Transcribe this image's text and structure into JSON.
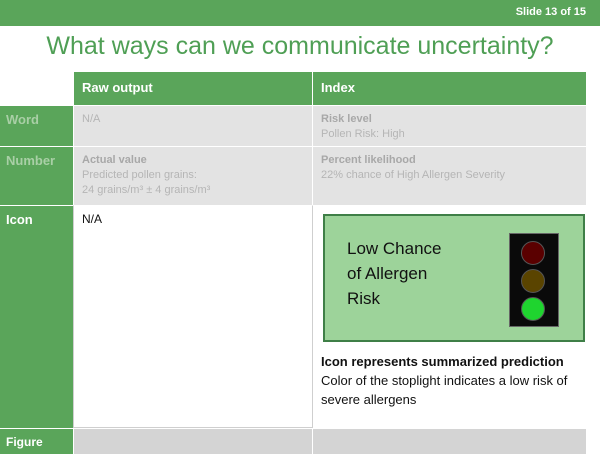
{
  "slide_number": "Slide 13 of 15",
  "title": "What ways can we communicate uncertainty?",
  "table": {
    "headers": [
      "",
      "Raw output",
      "Index"
    ],
    "word": {
      "label": "Word",
      "raw": "N/A",
      "index_title": "Risk level",
      "index_text": "Pollen Risk: High"
    },
    "number": {
      "label": "Number",
      "raw_title": "Actual value",
      "raw_line1": "Predicted pollen grains:",
      "raw_line2": "24 grains/m³ ± 4 grains/m³",
      "index_title": "Percent likelihood",
      "index_text": "22% chance of High Allergen Severity"
    },
    "icon": {
      "label": "Icon",
      "raw": "N/A",
      "icon_text_line1": "Low Chance",
      "icon_text_line2": "of Allergen",
      "icon_text_line3": "Risk",
      "caption_bold": "Icon represents summarized prediction",
      "caption_text": " Color of the stoplight indicates a low risk of severe allergens"
    },
    "figure": {
      "label": "Figure"
    }
  },
  "stoplight": {
    "icon": "traffic-light-icon",
    "red": "#5a0000",
    "yellow": "#5a4400",
    "green": "#1fd42f",
    "active": "green"
  },
  "colors": {
    "accent": "#5aa55a",
    "title": "#4f9f55",
    "icon_box": "#9dd39a"
  }
}
